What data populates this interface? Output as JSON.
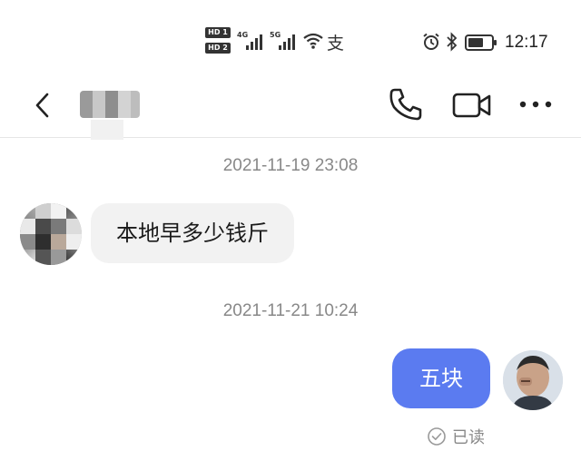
{
  "status_bar": {
    "hd_tags": [
      "HD 1",
      "HD 2"
    ],
    "sim1_network": "4G",
    "sim2_network": "5G",
    "pay_glyph": "支",
    "time": "12:17",
    "icons": [
      "hd-icon",
      "signal-icon",
      "wifi-icon",
      "alipay-icon",
      "alarm-icon",
      "bluetooth-icon",
      "battery-icon"
    ]
  },
  "header": {
    "contact_name": "",
    "icons": [
      "back-arrow-icon",
      "phone-icon",
      "video-camera-icon",
      "more-icon"
    ]
  },
  "chat": {
    "messages": [
      {
        "timestamp": "2021-11-19 23:08",
        "sender": "contact",
        "text": "本地早多少钱斤"
      },
      {
        "timestamp": "2021-11-21 10:24",
        "sender": "me",
        "text": "五块",
        "status": "已读"
      }
    ]
  },
  "colors": {
    "outgoing_bubble": "#5b7bf0",
    "incoming_bubble": "#f2f2f2",
    "timestamp_text": "#888888",
    "background": "#ffffff"
  }
}
